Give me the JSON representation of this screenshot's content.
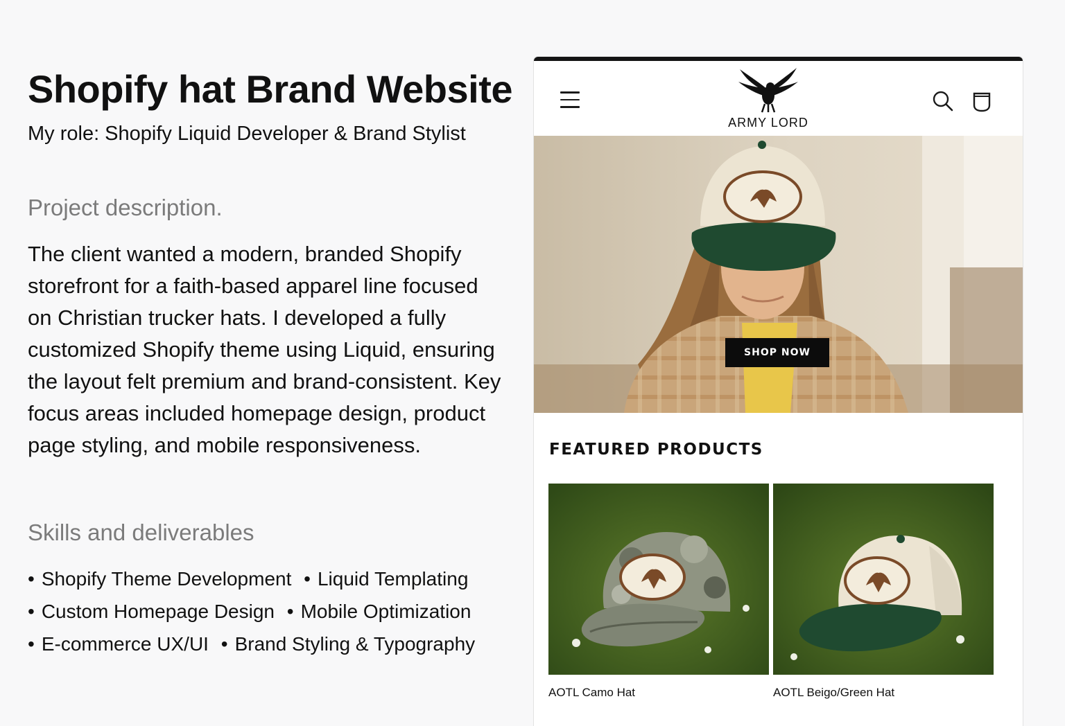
{
  "left": {
    "title": "Shopify hat Brand Website",
    "role": "My role: Shopify Liquid Developer & Brand Stylist",
    "description_heading": "Project description.",
    "description": "The client wanted a modern, branded Shopify storefront for a faith-based apparel line focused on Christian trucker hats. I developed a fully customized Shopify theme using Liquid, ensuring the layout felt premium and brand-consistent. Key focus areas included homepage design, product page styling, and mobile responsiveness.",
    "skills_heading": "Skills and deliverables",
    "skills": [
      "Shopify Theme Development",
      "Liquid Templating",
      "Custom Homepage Design",
      "Mobile Optimization",
      "E-commerce UX/UI",
      "Brand Styling & Typography"
    ]
  },
  "store": {
    "logo_text": "ARMY LORD",
    "hero_button": "SHOP NOW",
    "featured_heading": "FEATURED PRODUCTS",
    "products": [
      {
        "name": "AOTL Camo Hat"
      },
      {
        "name": "AOTL Beigo/Green Hat"
      }
    ]
  },
  "colors": {
    "header_bar": "#141414",
    "cap_green": "#1f4a30",
    "cap_cream": "#ece4d2",
    "patch_brown": "#7a4a28",
    "grass": "#3d5a1c"
  }
}
